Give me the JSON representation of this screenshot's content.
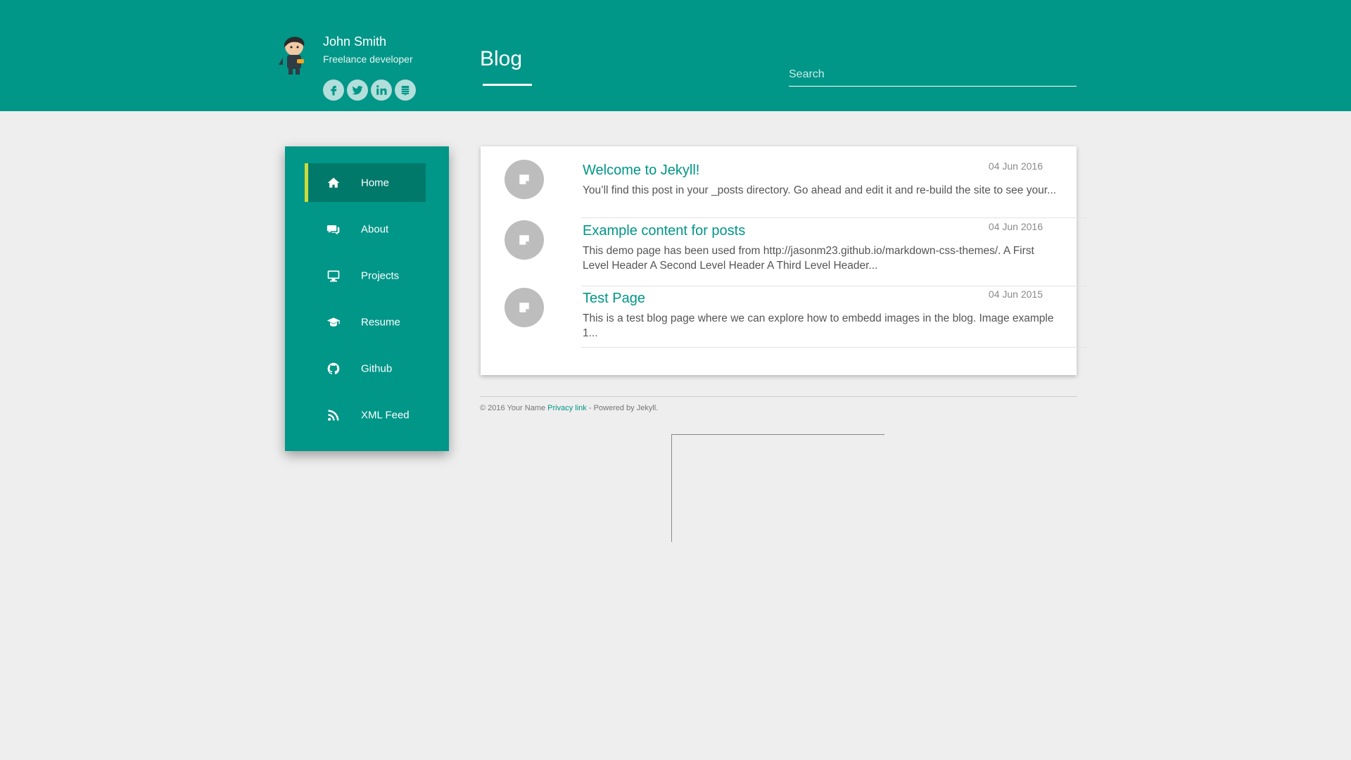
{
  "profile": {
    "name": "John Smith",
    "role": "Freelance developer",
    "social_icons": [
      "facebook-icon",
      "twitter-icon",
      "linkedin-icon",
      "stackexchange-icon"
    ]
  },
  "header": {
    "page_title": "Blog",
    "search_placeholder": "Search"
  },
  "sidebar": {
    "items": [
      {
        "label": "Home",
        "icon": "home-icon",
        "active": true
      },
      {
        "label": "About",
        "icon": "comments-icon",
        "active": false
      },
      {
        "label": "Projects",
        "icon": "desktop-icon",
        "active": false
      },
      {
        "label": "Resume",
        "icon": "graduation-cap-icon",
        "active": false
      },
      {
        "label": "Github",
        "icon": "github-icon",
        "active": false
      },
      {
        "label": "XML Feed",
        "icon": "rss-icon",
        "active": false
      }
    ]
  },
  "posts": [
    {
      "title": "Welcome to Jekyll!",
      "date": "04 Jun 2016",
      "excerpt": "You’ll find this post in your _posts directory. Go ahead and edit it and re-build the site to see your..."
    },
    {
      "title": "Example content for posts",
      "date": "04 Jun 2016",
      "excerpt": "This demo page has been used from http://jasonm23.github.io/markdown-css-themes/. A First Level Header A Second Level Header A Third Level Header..."
    },
    {
      "title": "Test Page",
      "date": "04 Jun 2015",
      "excerpt": "This is a test blog page where we can explore how to embedd images in the blog. Image example 1..."
    }
  ],
  "footer": {
    "copyright": "© 2016 Your Name ",
    "privacy_link": "Privacy link",
    "powered": " - Powered by Jekyll."
  },
  "colors": {
    "primary": "#009688",
    "primary_dark": "#00796b",
    "accent": "#cddc39",
    "background": "#eeeeee"
  }
}
